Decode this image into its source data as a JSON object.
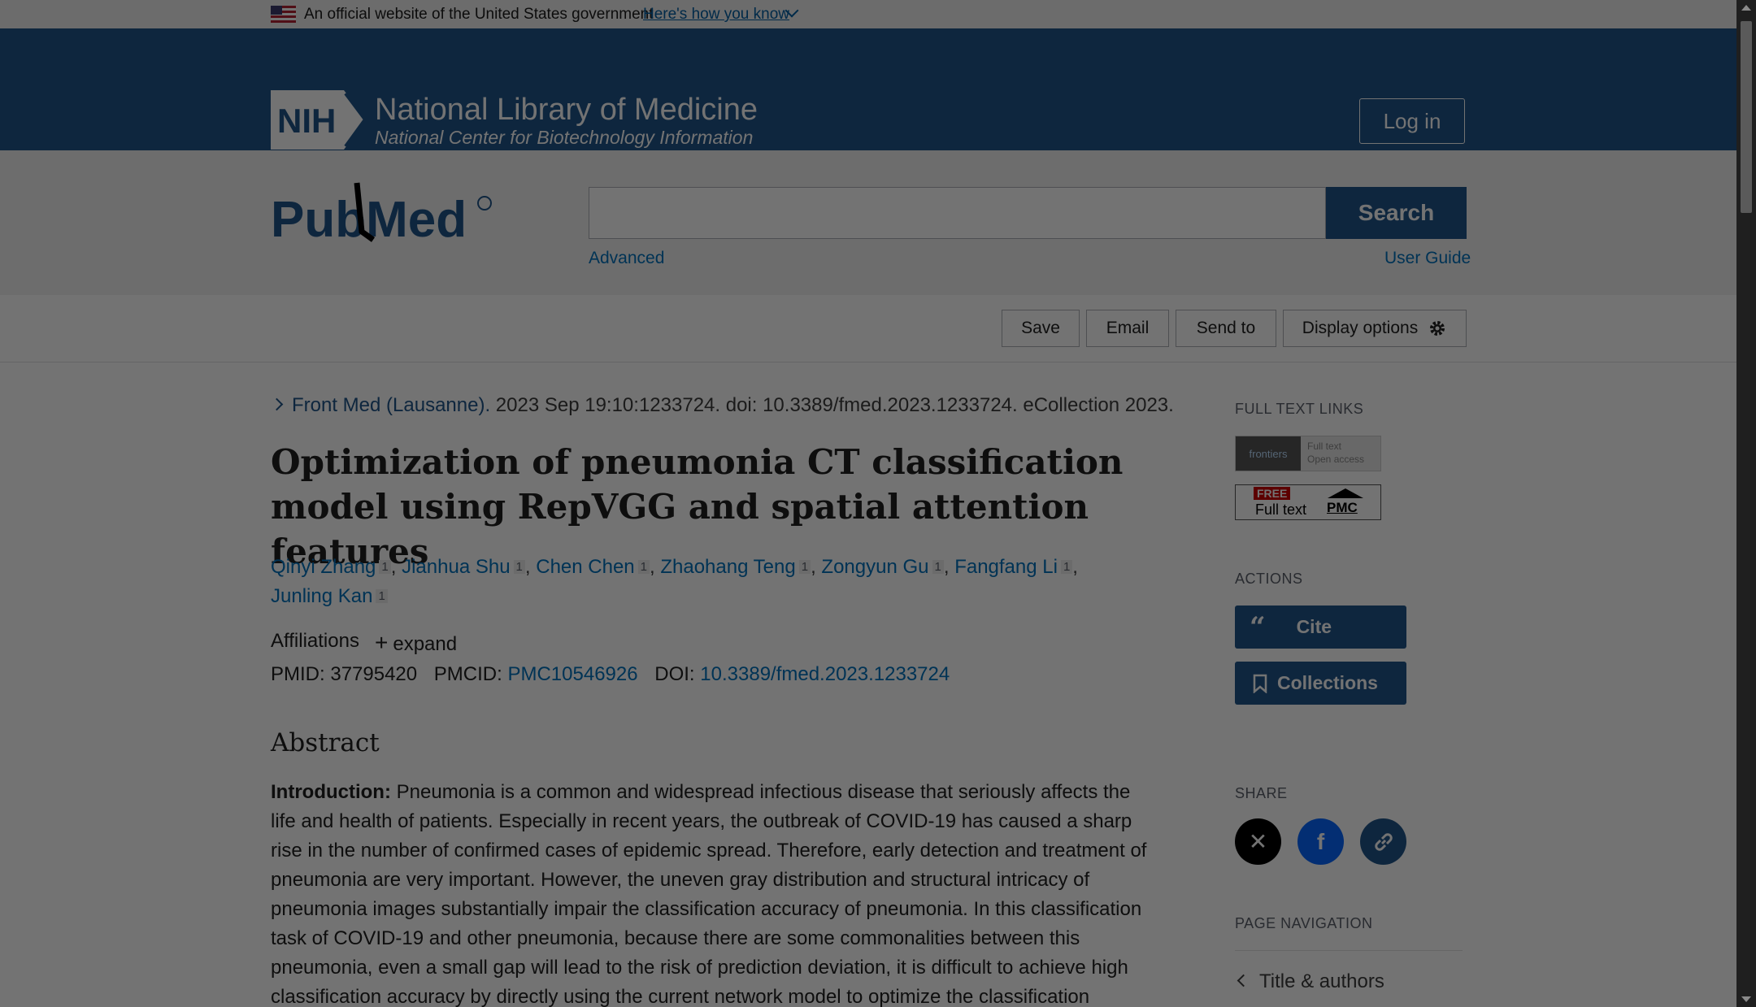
{
  "gov_banner": {
    "text": "An official website of the United States government",
    "link": "Here's how you know"
  },
  "header": {
    "logo_text": "NIH",
    "org_title": "National Library of Medicine",
    "org_subtitle": "National Center for Biotechnology Information",
    "login_label": "Log in"
  },
  "search": {
    "logo_text": "PubMed",
    "placeholder": "",
    "button_label": "Search",
    "advanced_label": "Advanced",
    "user_guide_label": "User Guide"
  },
  "toolbar": {
    "save": "Save",
    "email": "Email",
    "send_to": "Send to",
    "display_options": "Display options"
  },
  "article": {
    "journal": "Front Med (Lausanne).",
    "citation_rest": " 2023 Sep 19:10:1233724. doi: 10.3389/fmed.2023.1233724. eCollection 2023.",
    "title": "Optimization of pneumonia CT classification model using RepVGG and spatial attention features",
    "authors": [
      {
        "name": "Qinyi Zhang",
        "aff": "1"
      },
      {
        "name": "Jianhua Shu",
        "aff": "1"
      },
      {
        "name": "Chen Chen",
        "aff": "1"
      },
      {
        "name": "Zhaohang Teng",
        "aff": "1"
      },
      {
        "name": "Zongyun Gu",
        "aff": "1"
      },
      {
        "name": "Fangfang Li",
        "aff": "1"
      },
      {
        "name": "Junling Kan",
        "aff": "1"
      }
    ],
    "affiliations_label": "Affiliations",
    "expand_label": "expand",
    "pmid_label": "PMID:",
    "pmid": "37795420",
    "pmcid_label": "PMCID:",
    "pmcid": "PMC10546926",
    "doi_label": "DOI:",
    "doi": "10.3389/fmed.2023.1233724",
    "abstract_heading": "Abstract",
    "abstract_intro_label": "Introduction:",
    "abstract_intro_text": " Pneumonia is a common and widespread infectious disease that seriously affects the life and health of patients. Especially in recent years, the outbreak of COVID-19 has caused a sharp rise in the number of confirmed cases of epidemic spread. Therefore, early detection and treatment of pneumonia are very important. However, the uneven gray distribution and structural intricacy of pneumonia images substantially impair the classification accuracy of pneumonia. In this classification task of COVID-19 and other pneumonia, because there are some commonalities between this pneumonia, even a small gap will lead to the risk of prediction deviation, it is difficult to achieve high classification accuracy by directly using the current network model to optimize the classification"
  },
  "sidebar": {
    "full_text_links_heading": "FULL TEXT LINKS",
    "frontiers_label": "frontiers",
    "frontiers_line1": "Full text",
    "frontiers_line2": "Open access",
    "pmc_free": "FREE",
    "pmc_fulltext": "Full text",
    "pmc_label": "PMC",
    "actions_heading": "ACTIONS",
    "cite_label": "Cite",
    "collections_label": "Collections",
    "share_heading": "SHARE",
    "page_nav_heading": "PAGE NAVIGATION",
    "page_nav_item": "Title & authors"
  },
  "colors": {
    "brand_blue": "#20558a",
    "link_blue": "#0071bc"
  }
}
